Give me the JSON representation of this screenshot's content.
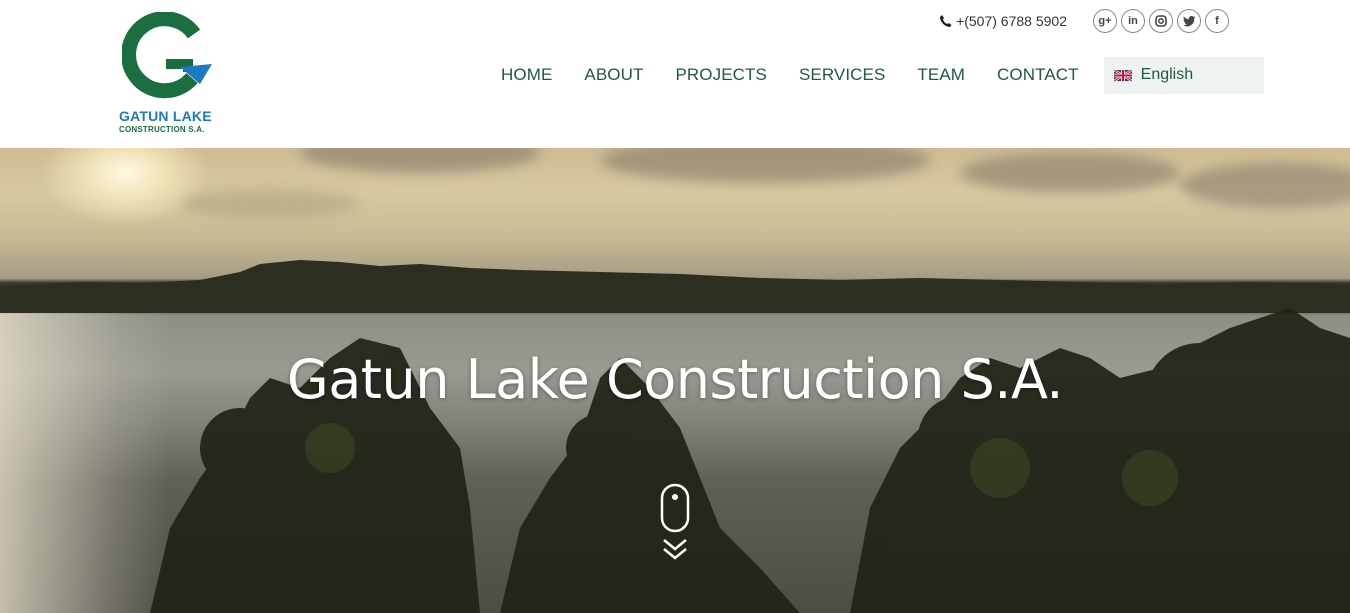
{
  "brand": {
    "name": "GATUN LAKE",
    "sub": "CONSTRUCTION  S.A.",
    "colors": {
      "green": "#1a6e3f",
      "blue": "#1e7abf"
    }
  },
  "topbar": {
    "phone": "+(507) 6788 5902",
    "socials": [
      {
        "icon": "google-plus-icon",
        "glyph": "g+"
      },
      {
        "icon": "linkedin-icon",
        "glyph": "in"
      },
      {
        "icon": "instagram-icon",
        "glyph": ""
      },
      {
        "icon": "twitter-icon",
        "glyph": ""
      },
      {
        "icon": "facebook-icon",
        "glyph": "f"
      }
    ]
  },
  "nav": {
    "items": [
      "HOME",
      "ABOUT",
      "PROJECTS",
      "SERVICES",
      "TEAM",
      "CONTACT"
    ],
    "language": "English"
  },
  "hero": {
    "title": "Gatun Lake Construction S.A."
  }
}
